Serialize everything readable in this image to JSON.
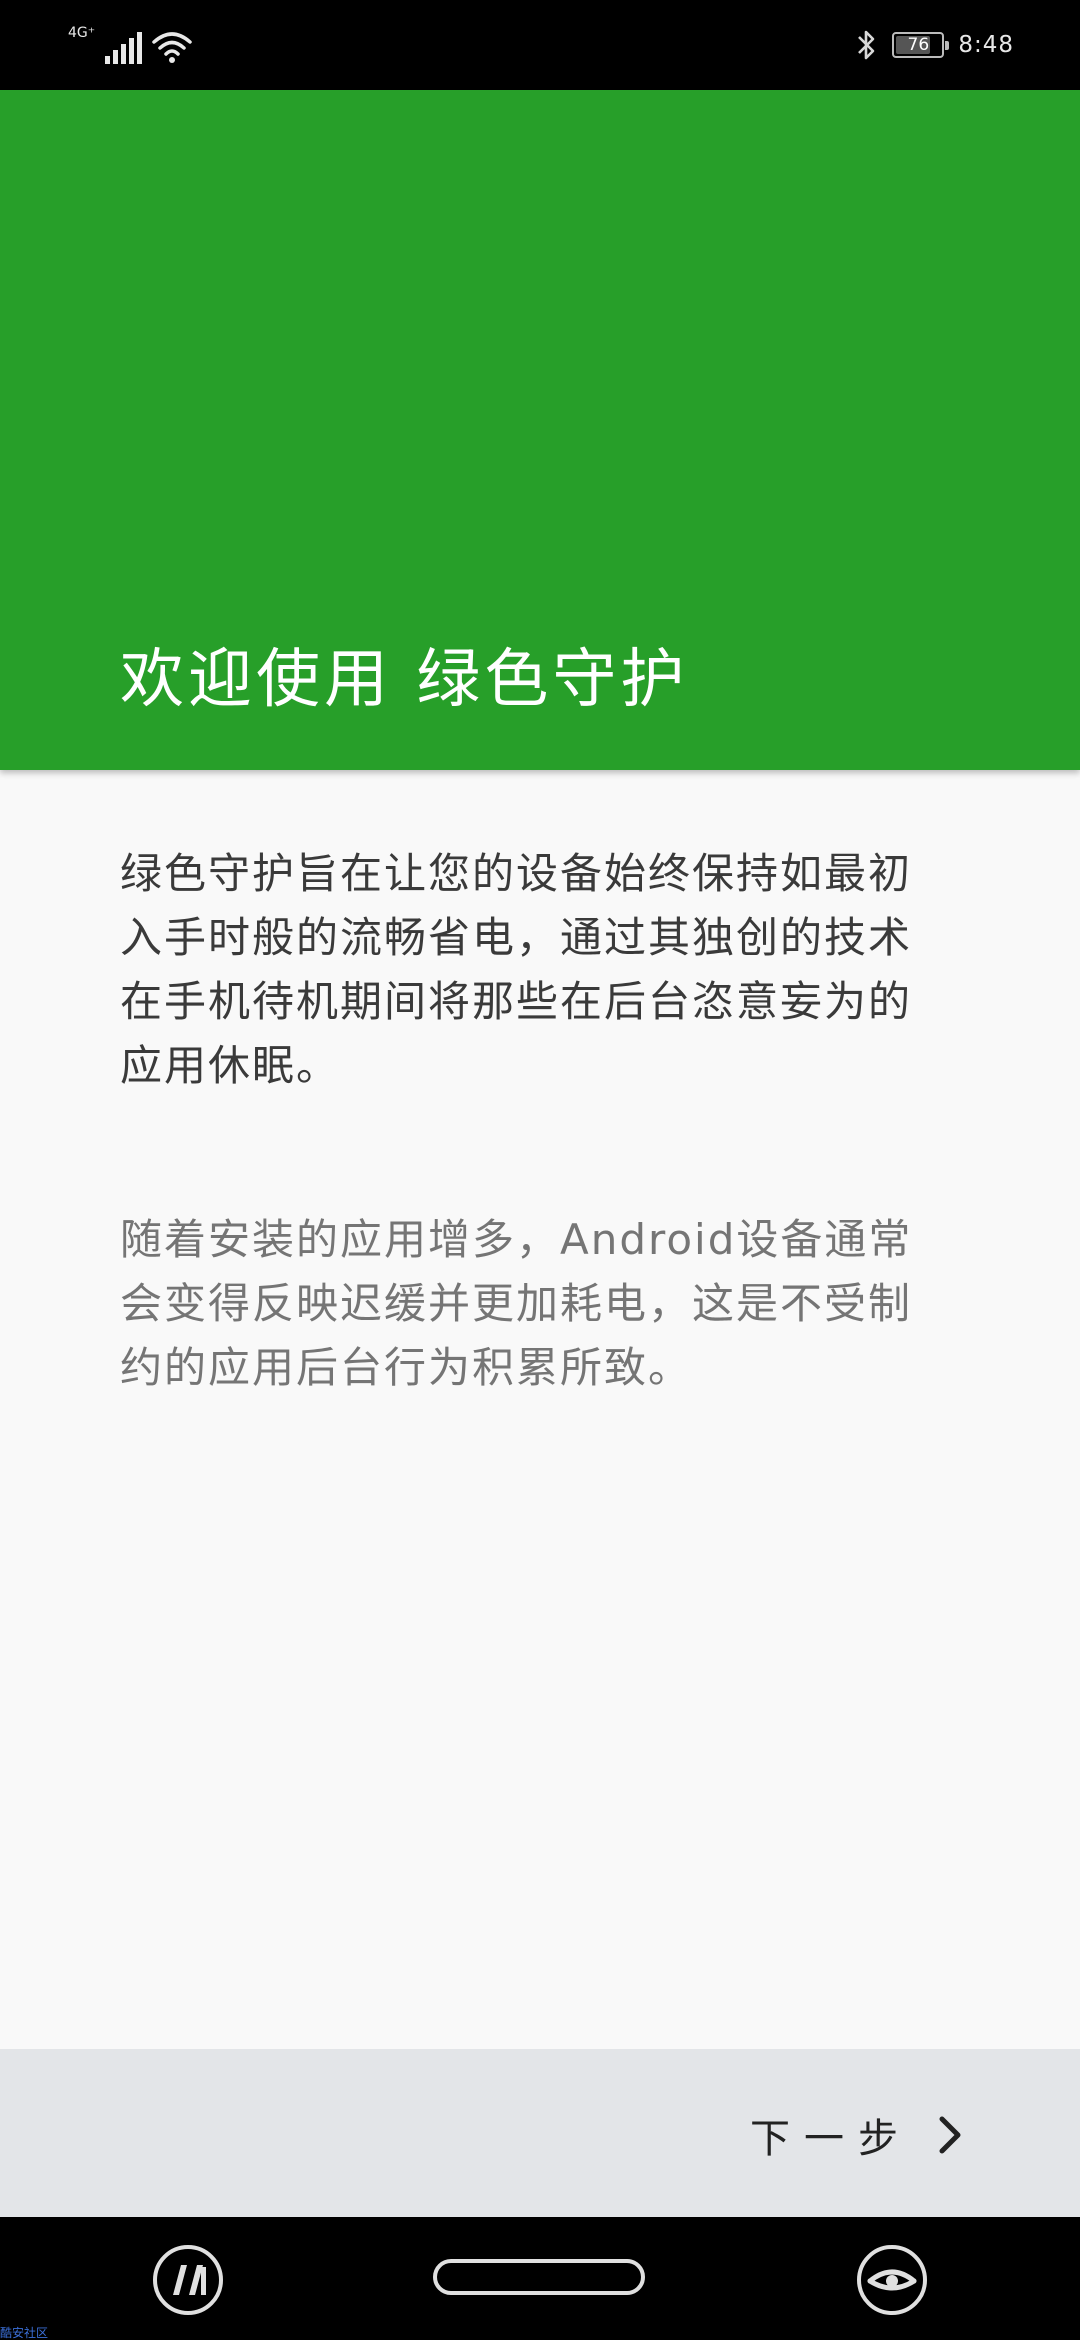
{
  "status_bar": {
    "network_type": "4G⁺",
    "battery_level": "76",
    "time": "8:48",
    "icons": [
      "signal-icon",
      "wifi-icon",
      "bluetooth-icon",
      "battery-icon"
    ]
  },
  "header": {
    "title": "欢迎使用 绿色守护",
    "background_color": "#279f29"
  },
  "content": {
    "paragraphs": [
      "绿色守护旨在让您的设备始终保持如最初入手时般的流畅省电，通过其独创的技术在手机待机期间将那些在后台恣意妄为的应用休眠。",
      "随着安装的应用增多，Android设备通常会变得反映迟缓并更加耗电，这是不受制约的应用后台行为积累所致。"
    ]
  },
  "footer": {
    "next_label": "下一步",
    "next_icon": "chevron-right-icon"
  },
  "nav_bar": {
    "icons": [
      "app-circle-icon",
      "home-pill",
      "eye-circle-icon"
    ]
  },
  "watermark": "酷安社区"
}
